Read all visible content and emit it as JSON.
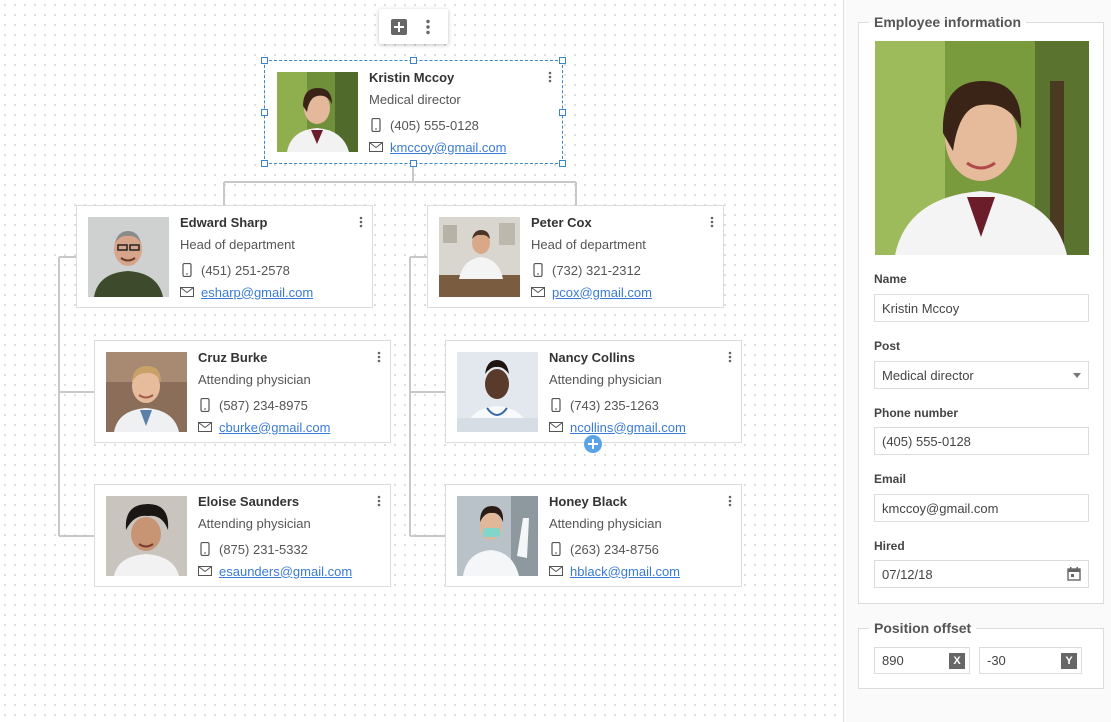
{
  "toolbar": {
    "add_icon": "plus-box-icon",
    "more_icon": "vertical-dots-icon"
  },
  "employees": [
    {
      "name": "Kristin Mccoy",
      "post": "Medical director",
      "phone": "(405) 555-0128",
      "email": "kmccoy@gmail.com"
    },
    {
      "name": "Edward Sharp",
      "post": "Head of department",
      "phone": "(451) 251-2578",
      "email": "esharp@gmail.com"
    },
    {
      "name": "Peter Cox",
      "post": "Head of department",
      "phone": "(732) 321-2312",
      "email": "pcox@gmail.com"
    },
    {
      "name": "Cruz Burke",
      "post": "Attending physician",
      "phone": "(587) 234-8975",
      "email": "cburke@gmail.com"
    },
    {
      "name": "Nancy Collins",
      "post": "Attending physician",
      "phone": "(743) 235-1263",
      "email": "ncollins@gmail.com"
    },
    {
      "name": "Eloise Saunders",
      "post": "Attending physician",
      "phone": "(875) 231-5332",
      "email": "esaunders@gmail.com"
    },
    {
      "name": "Honey Black",
      "post": "Attending physician",
      "phone": "(263) 234-8756",
      "email": "hblack@gmail.com"
    }
  ],
  "panel": {
    "title": "Employee information",
    "name_label": "Name",
    "name_value": "Kristin Mccoy",
    "post_label": "Post",
    "post_value": "Medical director",
    "phone_label": "Phone number",
    "phone_value": "(405) 555-0128",
    "email_label": "Email",
    "email_value": "kmccoy@gmail.com",
    "hired_label": "Hired",
    "hired_value": "07/12/18",
    "offset_title": "Position offset",
    "offset_x": "890",
    "offset_y": "-30",
    "x_badge": "X",
    "y_badge": "Y"
  },
  "colors": {
    "accent": "#3a7bd5",
    "selection": "#3a86c8",
    "add_button": "#5aa3e8"
  }
}
